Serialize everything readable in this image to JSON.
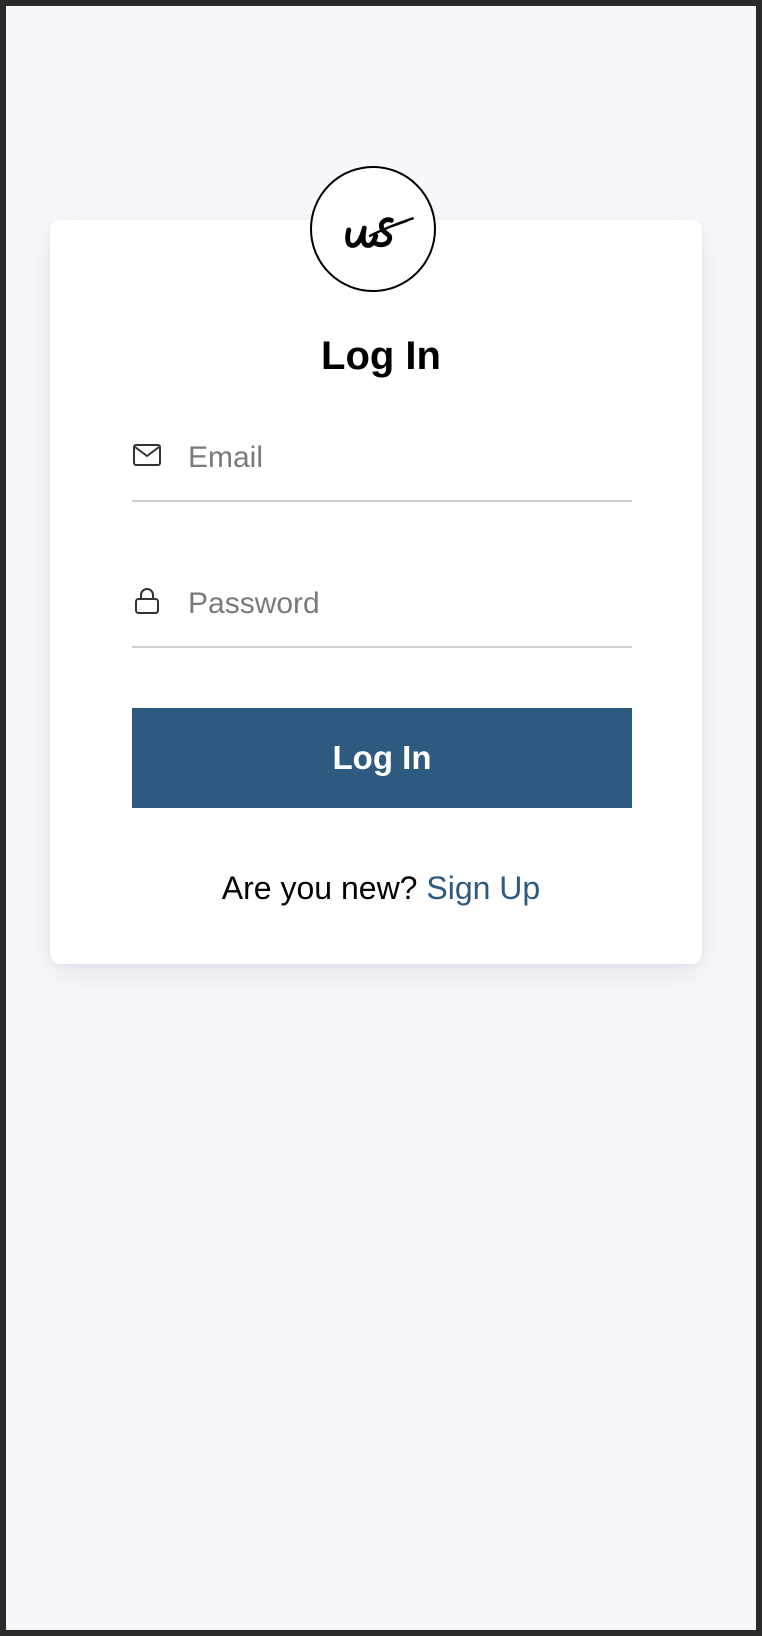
{
  "logo": {
    "text": "us"
  },
  "form": {
    "title": "Log In",
    "email": {
      "placeholder": "Email",
      "value": "",
      "icon": "envelope-icon"
    },
    "password": {
      "placeholder": "Password",
      "value": "",
      "icon": "lock-icon"
    },
    "submit_label": "Log In"
  },
  "footer": {
    "prompt": "Are you new?",
    "signup_link": "Sign Up"
  },
  "colors": {
    "accent": "#2e5a80",
    "background": "#f7f8fb",
    "card": "#ffffff"
  }
}
